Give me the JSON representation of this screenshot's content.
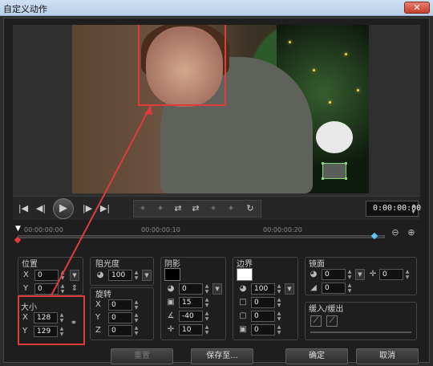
{
  "window": {
    "title": "自定义动作",
    "close_glyph": "✕"
  },
  "preview": {},
  "transport": {
    "timecode": "0:00:00:00",
    "buttons": [
      "|◀",
      "◀|",
      "▶",
      "|▶",
      "▶|"
    ],
    "tools": [
      "✦",
      "✦",
      "⇄",
      "⇄",
      "✦",
      "✦",
      "↻"
    ]
  },
  "timeline": {
    "ticks": [
      "00:00:00:00",
      "00:00:00:10",
      "00:00:00:20"
    ]
  },
  "properties": {
    "position": {
      "label": "位置",
      "x": "0",
      "y": "0"
    },
    "size": {
      "label": "大小",
      "x": "128",
      "y": "129"
    },
    "opacity": {
      "label": "阻光度",
      "value": "100"
    },
    "rotation": {
      "label": "旋转",
      "x": "0",
      "y": "0",
      "z": "0"
    },
    "shadow": {
      "label": "阴影",
      "color": "#000000",
      "v1": "0",
      "v2": "15",
      "angle": "-40",
      "offset": "10"
    },
    "border": {
      "label": "边界",
      "color": "#ffffff",
      "opacity": "100",
      "b1": "0",
      "b2": "0",
      "b3": "0"
    },
    "mirror": {
      "label": "镜面",
      "v1": "0",
      "v2": "0",
      "pos": "0"
    },
    "ease": {
      "label": "缓入/缓出"
    }
  },
  "buttons": {
    "reset": "重置",
    "save_to": "保存至...",
    "ok": "确定",
    "cancel": "取消"
  },
  "colors": {
    "highlight": "#e03c3c",
    "keyframe_end": "#5cc8ff",
    "selection": "#7fdc6a"
  }
}
